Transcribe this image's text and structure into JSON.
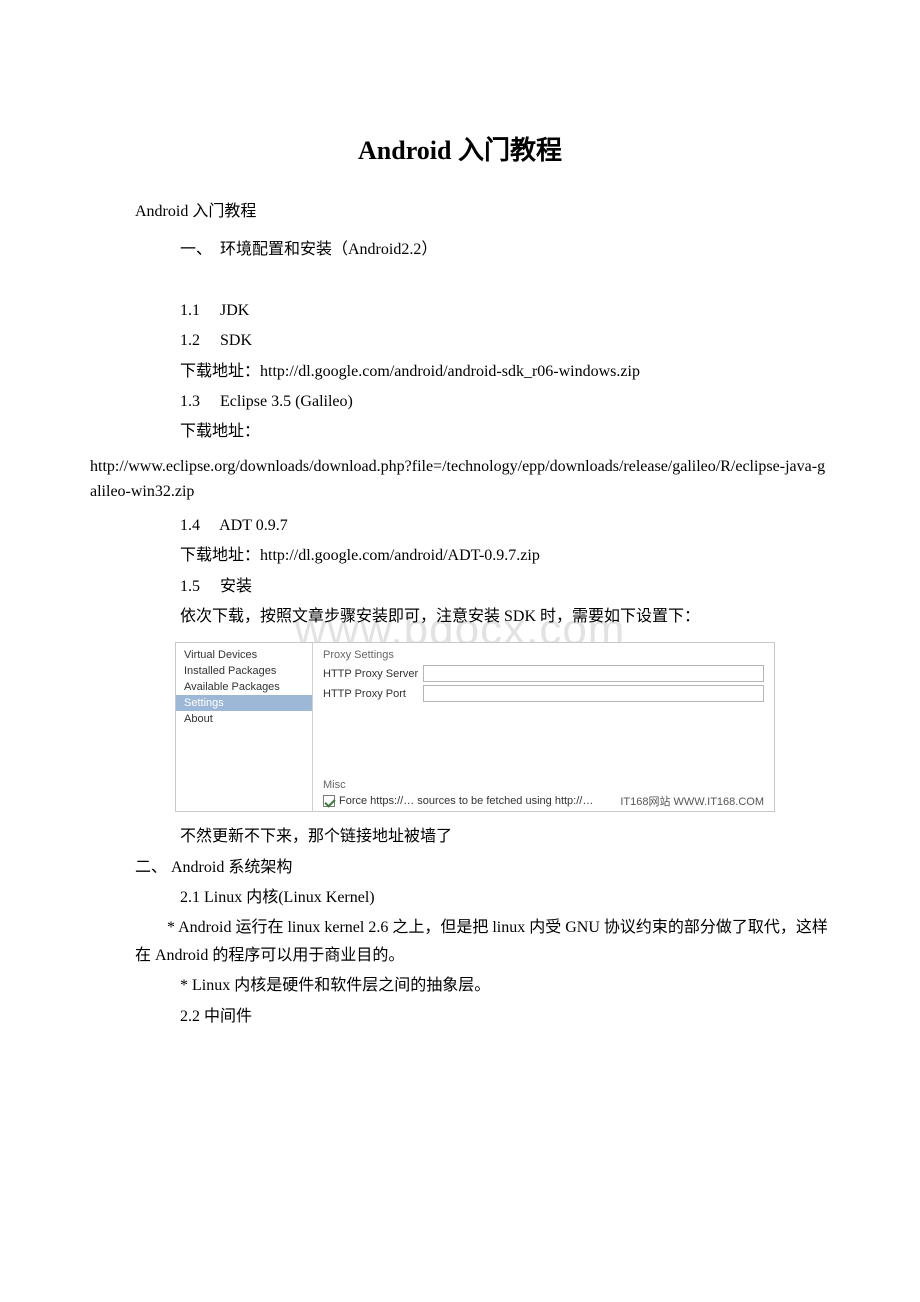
{
  "title": "Android 入门教程",
  "subtitle": "Android 入门教程",
  "section1_heading": "一、　环境配置和安装（Android2.2）",
  "items": {
    "i1_1": "1.1　 JDK",
    "i1_2": "1.2　 SDK",
    "sdk_url_label": "下载地址：http://dl.google.com/android/android-sdk_r06-windows.zip",
    "i1_3": "1.3　 Eclipse 3.5 (Galileo)",
    "eclipse_label": "下载地址：",
    "eclipse_url": "http://www.eclipse.org/downloads/download.php?file=/technology/epp/downloads/release/galileo/R/eclipse-java-galileo-win32.zip",
    "i1_4": "1.4　 ADT 0.9.7",
    "adt_url_label": "下载地址：http://dl.google.com/android/ADT-0.9.7.zip",
    "i1_5": "1.5　 安装",
    "install_note": "依次下载，按照文章步骤安装即可，注意安装 SDK 时，需要如下设置下：",
    "after_screenshot": "不然更新不下来，那个链接地址被墙了"
  },
  "section2_heading": "二、 Android 系统架构",
  "section2": {
    "s2_1_title": "2.1 Linux 内核(Linux Kernel)",
    "s2_1_p1": "　　* Android 运行在 linux kernel 2.6 之上，但是把 linux 内受 GNU 协议约束的部分做了取代，这样在 Android 的程序可以用于商业目的。",
    "s2_1_p2": "* Linux 内核是硬件和软件层之间的抽象层。",
    "s2_2_title": "2.2 中间件"
  },
  "screenshot": {
    "sidebar": {
      "item0": "Virtual Devices",
      "item1": "Installed Packages",
      "item2": "Available Packages",
      "item3_selected": "Settings",
      "item4": "About"
    },
    "proxy_group": "Proxy Settings",
    "proxy_server_label": "HTTP Proxy Server",
    "proxy_port_label": "HTTP Proxy Port",
    "misc_group": "Misc",
    "checkbox_label": "Force https://… sources to be fetched using http://…",
    "watermark_small": "IT168网站  WWW.IT168.COM"
  },
  "watermark_main": "www.bdocx.com"
}
